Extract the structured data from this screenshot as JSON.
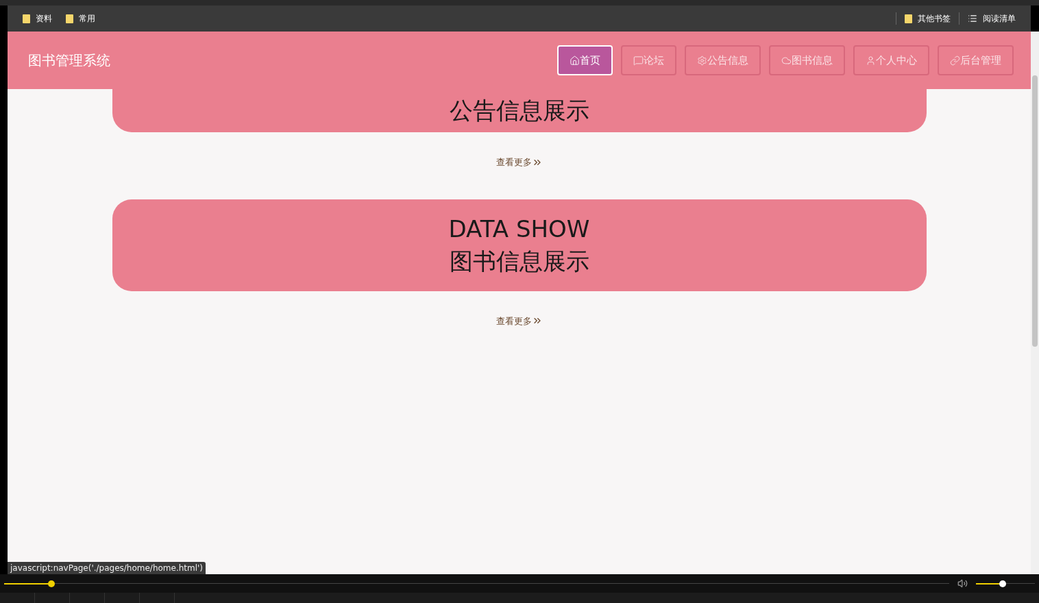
{
  "bookmarks_bar": {
    "left": [
      {
        "label": "资料"
      },
      {
        "label": "常用"
      }
    ],
    "right": [
      {
        "label": "其他书签",
        "kind": "folder"
      },
      {
        "label": "阅读清单",
        "kind": "list"
      }
    ]
  },
  "header": {
    "title": "图书管理系统",
    "nav": [
      {
        "label": "首页",
        "selected": true
      },
      {
        "label": "论坛",
        "selected": false
      },
      {
        "label": "公告信息",
        "selected": false
      },
      {
        "label": "图书信息",
        "selected": false
      },
      {
        "label": "个人中心",
        "selected": false
      },
      {
        "label": "后台管理",
        "selected": false
      }
    ]
  },
  "sections": [
    {
      "titles": [
        "公告信息展示"
      ],
      "more": "查看更多"
    },
    {
      "titles": [
        "DATA SHOW",
        "图书信息展示"
      ],
      "more": "查看更多"
    }
  ],
  "status_url": "javascript:navPage('./pages/home/home.html')",
  "player": {
    "progress": {
      "level": 0.05
    },
    "volume": {
      "level": 0.45
    }
  }
}
